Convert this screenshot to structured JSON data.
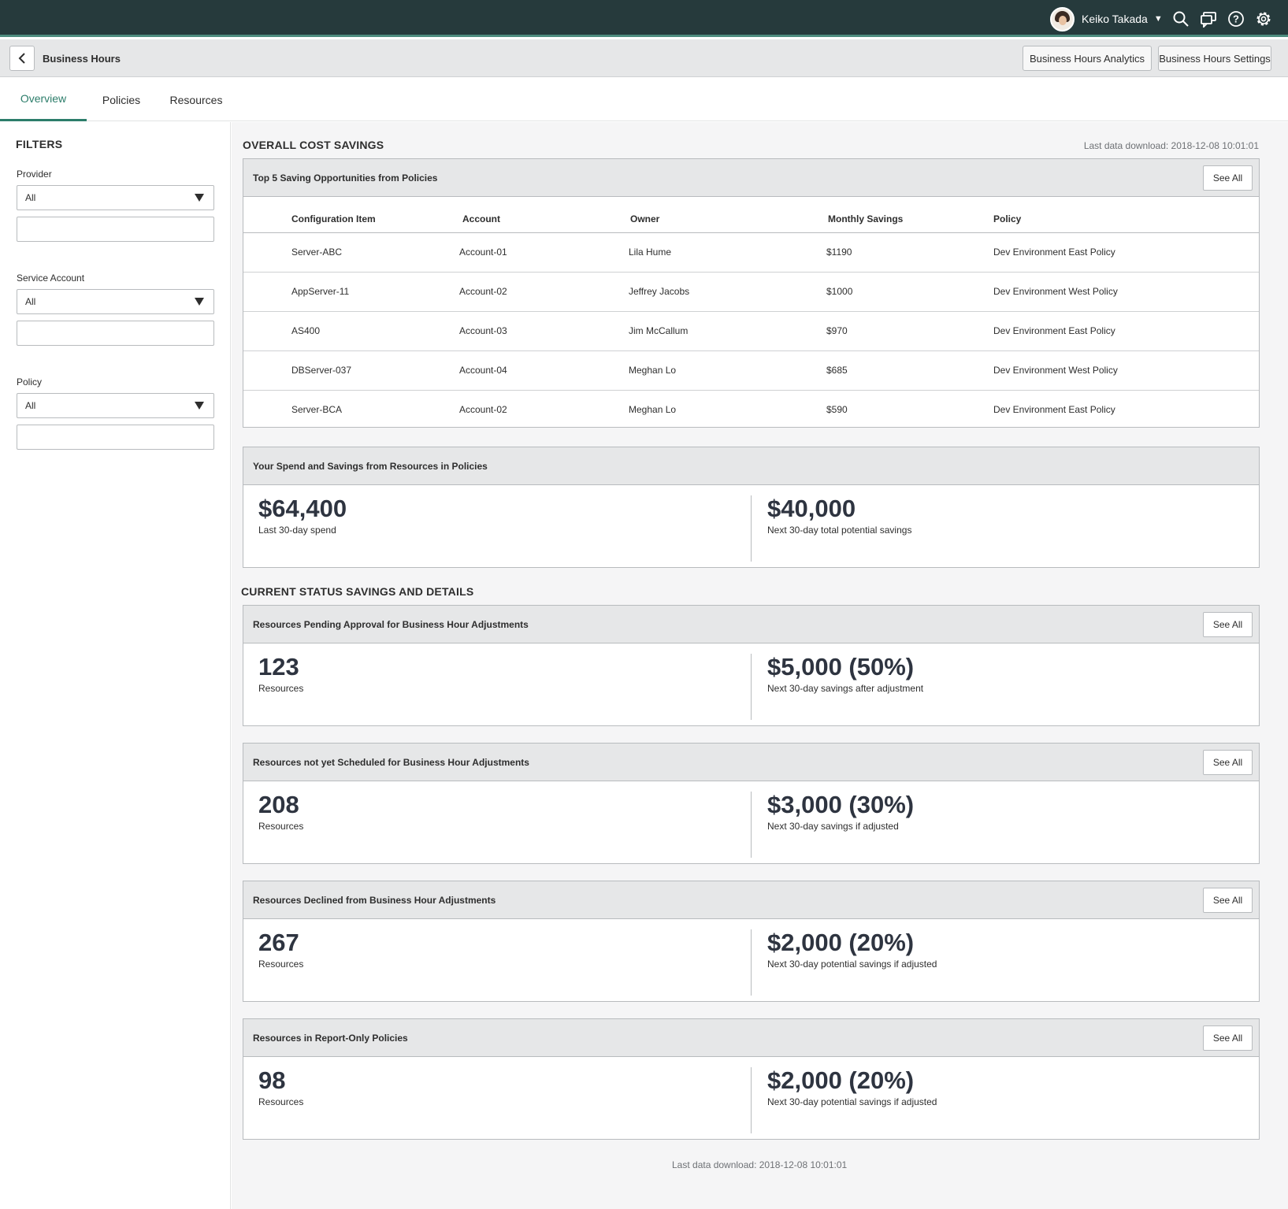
{
  "topbar": {
    "user_name": "Keiko Takada",
    "icons": [
      "search-icon",
      "chat-icon",
      "help-icon",
      "gear-icon"
    ]
  },
  "header": {
    "title": "Business Hours",
    "analytics_label": "Business Hours Analytics",
    "settings_label": "Business Hours Settings"
  },
  "tabs": [
    "Overview",
    "Policies",
    "Resources"
  ],
  "active_tab": "Overview",
  "filters": {
    "title": "FILTERS",
    "provider": {
      "label": "Provider",
      "value": "All"
    },
    "service_account": {
      "label": "Service Account",
      "value": "All"
    },
    "policy": {
      "label": "Policy",
      "value": "All"
    }
  },
  "overall": {
    "title": "OVERALL COST SAVINGS",
    "last_download": "Last data download: 2018-12-08 10:01:01"
  },
  "top5": {
    "title": "Top 5 Saving Opportunities from Policies",
    "see_all": "See All",
    "columns": [
      "Configuration Item",
      "Account",
      "Owner",
      "Monthly Savings",
      "Policy"
    ],
    "rows": [
      [
        "Server-ABC",
        "Account-01",
        "Lila Hume",
        "$1190",
        "Dev Environment East Policy"
      ],
      [
        "AppServer-11",
        "Account-02",
        "Jeffrey Jacobs",
        "$1000",
        "Dev Environment West Policy"
      ],
      [
        "AS400",
        "Account-03",
        "Jim McCallum",
        "$970",
        "Dev Environment East Policy"
      ],
      [
        "DBServer-037",
        "Account-04",
        "Meghan Lo",
        "$685",
        "Dev Environment West Policy"
      ],
      [
        "Server-BCA",
        "Account-02",
        "Meghan Lo",
        "$590",
        "Dev Environment East Policy"
      ]
    ]
  },
  "spend": {
    "title": "Your Spend and Savings from Resources in Policies",
    "left_value": "$64,400",
    "left_label": "Last 30-day spend",
    "right_value": "$40,000",
    "right_label": "Next 30-day total potential savings"
  },
  "current": {
    "title": "CURRENT STATUS SAVINGS AND DETAILS",
    "cards": [
      {
        "title": "Resources Pending Approval for Business Hour Adjustments",
        "see_all": "See All",
        "count": "123",
        "count_label": "Resources",
        "savings": "$5,000 (50%)",
        "savings_label": "Next 30-day savings after adjustment"
      },
      {
        "title": "Resources not yet Scheduled for Business Hour Adjustments",
        "see_all": "See All",
        "count": "208",
        "count_label": "Resources",
        "savings": "$3,000 (30%)",
        "savings_label": "Next 30-day savings if adjusted"
      },
      {
        "title": "Resources Declined from Business Hour Adjustments",
        "see_all": "See All",
        "count": "267",
        "count_label": "Resources",
        "savings": "$2,000 (20%)",
        "savings_label": "Next 30-day potential savings if adjusted"
      },
      {
        "title": "Resources in Report-Only Policies",
        "see_all": "See All",
        "count": "98",
        "count_label": "Resources",
        "savings": "$2,000 (20%)",
        "savings_label": "Next 30-day potential savings if adjusted"
      }
    ]
  },
  "footer": {
    "last_download": "Last data download: 2018-12-08 10:01:01"
  },
  "colors": {
    "topbar": "#263a3c",
    "accent": "#2c7d6a",
    "header_gray": "#e6e7e8"
  }
}
